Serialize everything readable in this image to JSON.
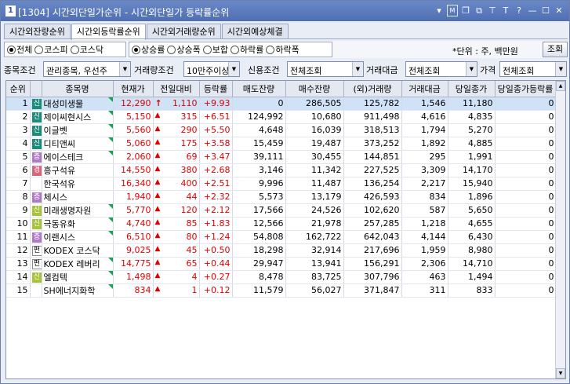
{
  "window": {
    "number": "1",
    "code": "[1304]",
    "title": "시간외단일가순위 - 시간외단일가 등락률순위",
    "icons": [
      "window-icon",
      "link-icon",
      "restore-icon",
      "pin-icon",
      "font-icon",
      "help-icon",
      "minimize-icon",
      "maximize-icon",
      "close-icon"
    ]
  },
  "tabs": [
    {
      "label": "시간외잔량순위"
    },
    {
      "label": "시간외등락률순위"
    },
    {
      "label": "시간외거래량순위"
    },
    {
      "label": "시간외예상체결"
    }
  ],
  "market_filter": [
    {
      "label": "전체",
      "checked": true
    },
    {
      "label": "코스피",
      "checked": false
    },
    {
      "label": "코스닥",
      "checked": false
    }
  ],
  "sort_filter": [
    {
      "label": "상승률",
      "checked": true
    },
    {
      "label": "상승폭",
      "checked": false
    },
    {
      "label": "보합",
      "checked": false
    },
    {
      "label": "하락률",
      "checked": false
    },
    {
      "label": "하락폭",
      "checked": false
    }
  ],
  "unit_text": "*단위 : 주, 백만원",
  "query_button": "조회",
  "filters": {
    "stock_cond_label": "종목조건",
    "stock_cond_value": "관리종목, 우선주",
    "volume_cond_label": "거래량조건",
    "volume_cond_value": "10만주이상",
    "credit_cond_label": "신용조건",
    "credit_cond_value": "전체조회",
    "amount_label": "거래대금",
    "amount_value": "전체조회",
    "price_label": "가격",
    "price_value": "전체조회"
  },
  "columns": [
    "순위",
    "",
    "종목명",
    "현재가",
    "전일대비",
    "등락률",
    "매도잔량",
    "매수잔량",
    "(외)거래량",
    "거래대금",
    "당일종가",
    "당일종가등락률"
  ],
  "colors": {
    "red": "#e00000",
    "green": "#1aa05a",
    "shin_badge": "#1a8c7a",
    "jeung_badge": "#b07ac8",
    "gyeong_badge": "#d9667f",
    "pyeon_badge": "#ffffff"
  },
  "rows": [
    {
      "rank": "1",
      "badge": "신",
      "badge_type": "shin",
      "name": "대성미생물",
      "price": "12,290",
      "change": "1,110",
      "upper": true,
      "rate": "+9.93",
      "ask": "0",
      "bid": "286,505",
      "volume": "125,782",
      "amount": "1,546",
      "close": "11,180",
      "close_rate": "0",
      "corner": true
    },
    {
      "rank": "2",
      "badge": "신",
      "badge_type": "shin",
      "name": "제이씨현시스",
      "price": "5,150",
      "change": "315",
      "upper": false,
      "rate": "+6.51",
      "ask": "124,992",
      "bid": "10,680",
      "volume": "911,498",
      "amount": "4,616",
      "close": "4,835",
      "close_rate": "0",
      "corner": true
    },
    {
      "rank": "3",
      "badge": "신",
      "badge_type": "shin",
      "name": "이글벳",
      "price": "5,560",
      "change": "290",
      "upper": false,
      "rate": "+5.50",
      "ask": "4,648",
      "bid": "16,039",
      "volume": "318,513",
      "amount": "1,794",
      "close": "5,270",
      "close_rate": "0",
      "corner": true
    },
    {
      "rank": "4",
      "badge": "신",
      "badge_type": "shin",
      "name": "디티앤씨",
      "price": "5,060",
      "change": "175",
      "upper": false,
      "rate": "+3.58",
      "ask": "15,459",
      "bid": "19,487",
      "volume": "373,252",
      "amount": "1,892",
      "close": "4,885",
      "close_rate": "0",
      "corner": true
    },
    {
      "rank": "5",
      "badge": "증",
      "badge_type": "jeung",
      "name": "에이스테크",
      "price": "2,060",
      "change": "69",
      "upper": false,
      "rate": "+3.47",
      "ask": "39,111",
      "bid": "30,455",
      "volume": "144,851",
      "amount": "295",
      "close": "1,991",
      "close_rate": "0",
      "corner": true
    },
    {
      "rank": "6",
      "badge": "경",
      "badge_type": "gyeong",
      "name": "흥구석유",
      "price": "14,550",
      "change": "380",
      "upper": false,
      "rate": "+2.68",
      "ask": "3,146",
      "bid": "11,342",
      "volume": "227,525",
      "amount": "3,309",
      "close": "14,170",
      "close_rate": "0",
      "corner": false
    },
    {
      "rank": "7",
      "badge": "",
      "badge_type": "none",
      "name": "한국석유",
      "price": "16,340",
      "change": "400",
      "upper": false,
      "rate": "+2.51",
      "ask": "9,996",
      "bid": "11,487",
      "volume": "136,254",
      "amount": "2,217",
      "close": "15,940",
      "close_rate": "0",
      "corner": false
    },
    {
      "rank": "8",
      "badge": "증",
      "badge_type": "jeung",
      "name": "체시스",
      "price": "1,940",
      "change": "44",
      "upper": false,
      "rate": "+2.32",
      "ask": "5,573",
      "bid": "13,179",
      "volume": "426,593",
      "amount": "834",
      "close": "1,896",
      "close_rate": "0",
      "corner": false
    },
    {
      "rank": "9",
      "badge": "신",
      "badge_type": "shin2",
      "name": "미래생명자원",
      "price": "5,770",
      "change": "120",
      "upper": false,
      "rate": "+2.12",
      "ask": "17,566",
      "bid": "24,526",
      "volume": "102,620",
      "amount": "587",
      "close": "5,650",
      "close_rate": "0",
      "corner": true
    },
    {
      "rank": "10",
      "badge": "신",
      "badge_type": "shin2",
      "name": "극동유화",
      "price": "4,740",
      "change": "85",
      "upper": false,
      "rate": "+1.83",
      "ask": "12,566",
      "bid": "21,978",
      "volume": "257,285",
      "amount": "1,218",
      "close": "4,655",
      "close_rate": "0",
      "corner": true
    },
    {
      "rank": "11",
      "badge": "증",
      "badge_type": "jeung",
      "name": "이랜시스",
      "price": "6,510",
      "change": "80",
      "upper": false,
      "rate": "+1.24",
      "ask": "54,808",
      "bid": "162,722",
      "volume": "642,043",
      "amount": "4,144",
      "close": "6,430",
      "close_rate": "0",
      "corner": true
    },
    {
      "rank": "12",
      "badge": "펀",
      "badge_type": "pyeon",
      "name": "KODEX 코스닥",
      "price": "9,025",
      "change": "45",
      "upper": false,
      "rate": "+0.50",
      "ask": "18,298",
      "bid": "32,914",
      "volume": "217,696",
      "amount": "1,959",
      "close": "8,980",
      "close_rate": "0",
      "corner": false
    },
    {
      "rank": "13",
      "badge": "펀",
      "badge_type": "pyeon",
      "name": "KODEX 레버리",
      "price": "14,775",
      "change": "65",
      "upper": false,
      "rate": "+0.44",
      "ask": "29,947",
      "bid": "13,941",
      "volume": "156,291",
      "amount": "2,306",
      "close": "14,710",
      "close_rate": "0",
      "corner": true
    },
    {
      "rank": "14",
      "badge": "신",
      "badge_type": "shin2",
      "name": "엘컴텍",
      "price": "1,498",
      "change": "4",
      "upper": false,
      "rate": "+0.27",
      "ask": "8,478",
      "bid": "83,725",
      "volume": "307,796",
      "amount": "463",
      "close": "1,494",
      "close_rate": "0",
      "corner": true
    },
    {
      "rank": "15",
      "badge": "",
      "badge_type": "none",
      "name": "SH에너지화학",
      "price": "834",
      "change": "1",
      "upper": false,
      "rate": "+0.12",
      "ask": "11,579",
      "bid": "56,027",
      "volume": "371,847",
      "amount": "311",
      "close": "833",
      "close_rate": "0",
      "corner": true
    }
  ]
}
